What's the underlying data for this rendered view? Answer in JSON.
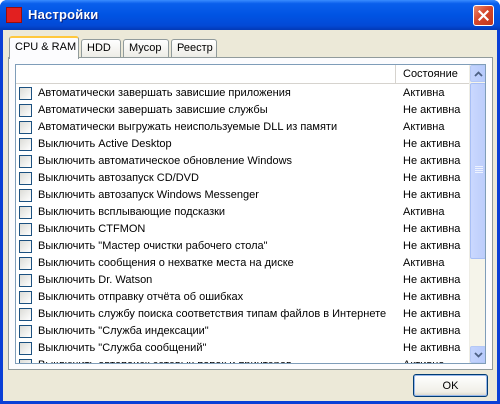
{
  "window": {
    "title": "Настройки",
    "icon": "app-icon"
  },
  "tabs": [
    {
      "label": "CPU & RAM",
      "active": true
    },
    {
      "label": "HDD",
      "active": false
    },
    {
      "label": "Мусор",
      "active": false
    },
    {
      "label": "Реестр",
      "active": false
    }
  ],
  "list": {
    "columns": [
      "",
      "Состояние"
    ],
    "rows": [
      {
        "name": "Автоматически завершать зависшие приложения",
        "state": "Активна",
        "checked": false
      },
      {
        "name": "Автоматически завершать зависшие службы",
        "state": "Не активна",
        "checked": false
      },
      {
        "name": "Автоматически выгружать неиспользуемые DLL из памяти",
        "state": "Активна",
        "checked": false
      },
      {
        "name": "Выключить Active Desktop",
        "state": "Не активна",
        "checked": false
      },
      {
        "name": "Выключить автоматическое обновление Windows",
        "state": "Не активна",
        "checked": false
      },
      {
        "name": "Выключить автозапуск CD/DVD",
        "state": "Не активна",
        "checked": false
      },
      {
        "name": "Выключить автозапуск Windows Messenger",
        "state": "Не активна",
        "checked": false
      },
      {
        "name": "Выключить всплывающие подсказки",
        "state": "Активна",
        "checked": false
      },
      {
        "name": "Выключить CTFMON",
        "state": "Не активна",
        "checked": false
      },
      {
        "name": "Выключить \"Мастер очистки рабочего стола\"",
        "state": "Не активна",
        "checked": false
      },
      {
        "name": "Выключить сообщения о нехватке места на диске",
        "state": "Активна",
        "checked": false
      },
      {
        "name": "Выключить Dr. Watson",
        "state": "Не активна",
        "checked": false
      },
      {
        "name": "Выключить отправку отчёта об ошибках",
        "state": "Не активна",
        "checked": false
      },
      {
        "name": "Выключить службу поиска соответствия типам файлов в Интернете",
        "state": "Не активна",
        "checked": false
      },
      {
        "name": "Выключить \"Служба индексации\"",
        "state": "Не активна",
        "checked": false
      },
      {
        "name": "Выключить \"Служба сообщений\"",
        "state": "Не активна",
        "checked": false
      },
      {
        "name": "Выключить автопоиск сетевых папок и принтеров",
        "state": "Активна",
        "checked": false
      }
    ]
  },
  "buttons": {
    "ok": "OK"
  },
  "colors": {
    "titlebar": "#0054e3",
    "close": "#d6472b",
    "app_icon": "#e22020",
    "dialog_bg": "#ece9d8",
    "tab_highlight": "#ffc83c"
  }
}
